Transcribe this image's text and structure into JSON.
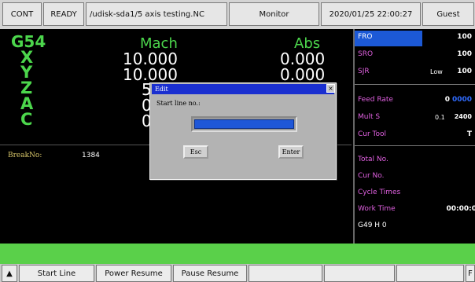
{
  "topbar": {
    "mode": "CONT",
    "status": "READY",
    "file": "/udisk-sda1/5 axis testing.NC",
    "screen": "Monitor",
    "datetime": "2020/01/25 22:00:27",
    "user": "Guest"
  },
  "coords": {
    "system": "G54",
    "mach_header": "Mach",
    "abs_header": "Abs",
    "axes": [
      {
        "name": "X",
        "mach": "10.000",
        "abs": "0.000"
      },
      {
        "name": "Y",
        "mach": "10.000",
        "abs": "0.000"
      },
      {
        "name": "Z",
        "mach": "5.",
        "abs": ""
      },
      {
        "name": "A",
        "mach": "0.",
        "abs": ""
      },
      {
        "name": "C",
        "mach": "0.",
        "abs": ""
      }
    ]
  },
  "lower": {
    "break_no_label": "BreakNo:",
    "break_no_value": "1384"
  },
  "right": {
    "fro_label": "FRO",
    "fro_value": "100",
    "sro_label": "SRO",
    "sro_value": "100",
    "sjr_label": "SJR",
    "sjr_mid": "Low",
    "sjr_value": "100",
    "feed_label": "Feed Rate",
    "feed_value": "0",
    "feed_blue": "0000",
    "mults_label": "Mult S",
    "mults_mid": "0.1",
    "mults_value": "2400",
    "curtool_label": "Cur Tool",
    "curtool_value": "T",
    "total_label": "Total No.",
    "curno_label": "Cur No.",
    "cycle_label": "Cycle Times",
    "work_label": "Work Time",
    "work_value": "00:00:0",
    "gcode": "G49 H 0"
  },
  "softkeys": {
    "up_arrow": "▲",
    "start_line": "Start Line",
    "power_resume": "Power Resume",
    "pause_resume": "Pause Resume",
    "right_char": "F"
  },
  "dialog": {
    "title": "Edit",
    "close": "×",
    "prompt": "Start line no.:",
    "input_value": "",
    "esc": "Esc",
    "enter": "Enter"
  }
}
